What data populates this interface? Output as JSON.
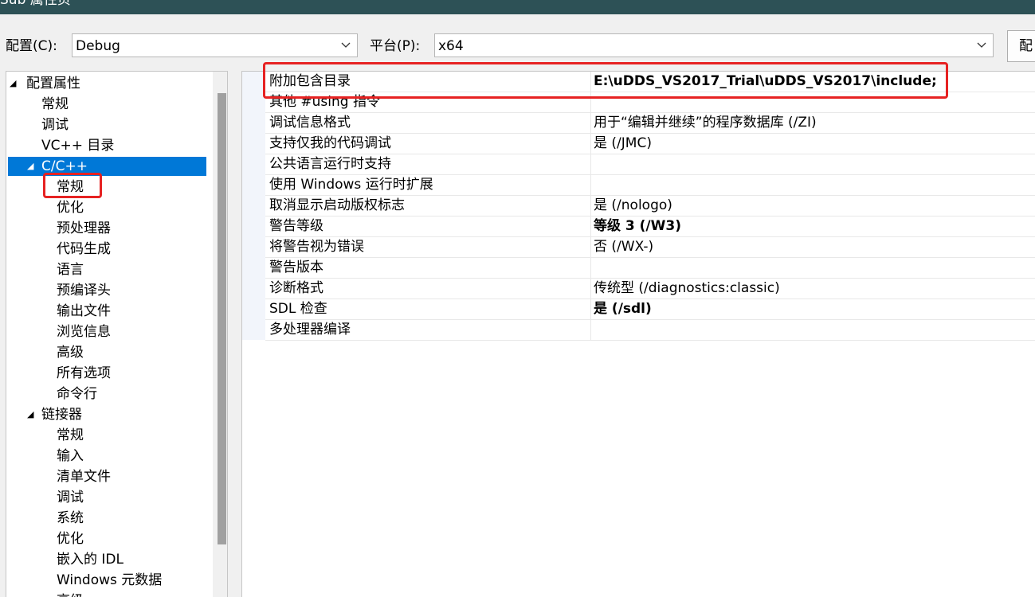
{
  "window": {
    "title": "Sub 属性页"
  },
  "toolbar": {
    "config_label": "配置(C):",
    "config_value": "Debug",
    "platform_label": "平台(P):",
    "platform_value": "x64",
    "config_manager_label": "配"
  },
  "tree": {
    "items": [
      {
        "label": "配置属性",
        "expanded": true
      },
      {
        "label": "常规"
      },
      {
        "label": "调试"
      },
      {
        "label": "VC++ 目录"
      },
      {
        "label": "C/C++",
        "expanded": true,
        "selected": true
      },
      {
        "label": "常规",
        "highlighted": true
      },
      {
        "label": "优化"
      },
      {
        "label": "预处理器"
      },
      {
        "label": "代码生成"
      },
      {
        "label": "语言"
      },
      {
        "label": "预编译头"
      },
      {
        "label": "输出文件"
      },
      {
        "label": "浏览信息"
      },
      {
        "label": "高级"
      },
      {
        "label": "所有选项"
      },
      {
        "label": "命令行"
      },
      {
        "label": "链接器",
        "expanded": true
      },
      {
        "label": "常规"
      },
      {
        "label": "输入"
      },
      {
        "label": "清单文件"
      },
      {
        "label": "调试"
      },
      {
        "label": "系统"
      },
      {
        "label": "优化"
      },
      {
        "label": "嵌入的 IDL"
      },
      {
        "label": "Windows 元数据"
      },
      {
        "label": "高级"
      }
    ]
  },
  "properties": [
    {
      "name": "附加包含目录",
      "value": "E:\\uDDS_VS2017_Trial\\uDDS_VS2017\\include;",
      "bold": true,
      "highlighted": true
    },
    {
      "name": "其他 #using 指令",
      "value": ""
    },
    {
      "name": "调试信息格式",
      "value": "用于“编辑并继续”的程序数据库 (/ZI)"
    },
    {
      "name": "支持仅我的代码调试",
      "value": "是 (/JMC)"
    },
    {
      "name": "公共语言运行时支持",
      "value": ""
    },
    {
      "name": "使用 Windows 运行时扩展",
      "value": ""
    },
    {
      "name": "取消显示启动版权标志",
      "value": "是 (/nologo)"
    },
    {
      "name": "警告等级",
      "value": "等级 3 (/W3)",
      "bold": true
    },
    {
      "name": "将警告视为错误",
      "value": "否 (/WX-)"
    },
    {
      "name": "警告版本",
      "value": ""
    },
    {
      "name": "诊断格式",
      "value": "传统型 (/diagnostics:classic)"
    },
    {
      "name": "SDL 检查",
      "value": "是 (/sdl)",
      "bold": true
    },
    {
      "name": "多处理器编译",
      "value": ""
    }
  ],
  "colors": {
    "title_bar": "#2d5156",
    "selection": "#0078d7",
    "highlight_box": "#e62222"
  }
}
